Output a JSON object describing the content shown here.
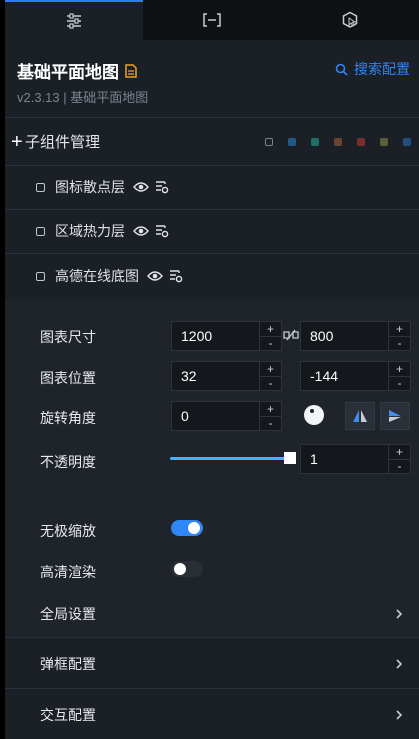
{
  "tabs": [
    {
      "icon": "sliders-icon",
      "active": true
    },
    {
      "icon": "bracket-minus-icon",
      "active": false
    },
    {
      "icon": "hexagon-pointer-icon",
      "active": false
    }
  ],
  "header": {
    "title": "基础平面地图",
    "search_config": "搜索配置",
    "version": "v2.3.13 | 基础平面地图"
  },
  "subcomponents": {
    "plus": "+",
    "label": "子组件管理",
    "color_dots": [
      "#1b1f26",
      "#1f5a85",
      "#1f6e67",
      "#6b4433",
      "#7a2f2f",
      "#5a5f3a",
      "#1f4f7f"
    ]
  },
  "layers": [
    {
      "name": "图标散点层"
    },
    {
      "name": "区域热力层"
    },
    {
      "name": "高德在线底图"
    }
  ],
  "props": {
    "size": {
      "label": "图表尺寸",
      "width": "1200",
      "height": "800"
    },
    "position": {
      "label": "图表位置",
      "x": "32",
      "y": "-144"
    },
    "rotation": {
      "label": "旋转角度",
      "value": "0"
    },
    "opacity": {
      "label": "不透明度",
      "value": "1",
      "level": 1.0
    },
    "spinner": {
      "plus": "+",
      "minus": "-"
    }
  },
  "toggles": {
    "zoom": {
      "label": "无极缩放",
      "on": true
    },
    "hd": {
      "label": "高清渲染",
      "on": false
    }
  },
  "sections": {
    "global": "全局设置",
    "popup": "弹框配置",
    "interact": "交互配置"
  },
  "colors": {
    "accent": "#2f86f6",
    "toggle_on": "#2f86f6",
    "toggle_off": "#2a2e35",
    "doc_icon": "#f0a020"
  }
}
